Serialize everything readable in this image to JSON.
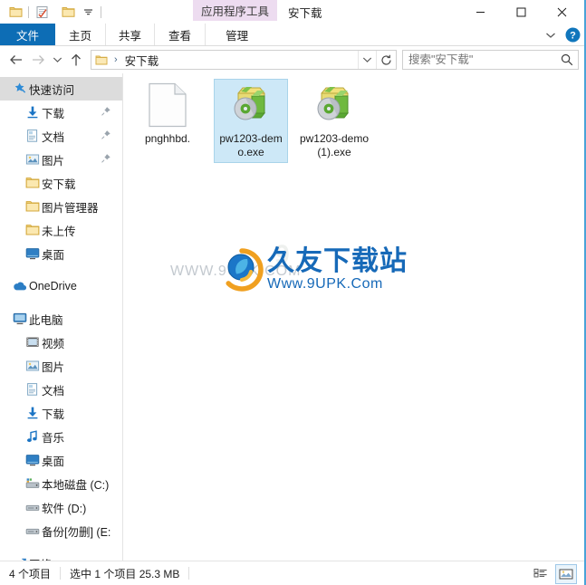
{
  "window": {
    "title": "安下载",
    "contextual_tab": "应用程序工具",
    "minimize_icon": "minimize-icon",
    "maximize_icon": "maximize-icon",
    "close_icon": "close-icon"
  },
  "quick_access_toolbar": {
    "items": [
      {
        "name": "folder-icon",
        "label": "属性"
      },
      {
        "name": "properties-icon",
        "label": "属性"
      },
      {
        "name": "new-folder-icon",
        "label": "新建文件夹"
      },
      {
        "name": "chevron-down-icon",
        "label": "自定义快速访问工具栏"
      }
    ]
  },
  "ribbon": {
    "tabs": [
      {
        "label": "文件",
        "selected": true
      },
      {
        "label": "主页",
        "selected": false
      },
      {
        "label": "共享",
        "selected": false
      },
      {
        "label": "查看",
        "selected": false
      },
      {
        "label": "管理",
        "selected": false
      }
    ],
    "expand_icon": "chevron-down-icon",
    "help_icon": "help-icon",
    "help_label": "?"
  },
  "address_bar": {
    "back_icon": "back-arrow-icon",
    "forward_icon": "forward-arrow-icon",
    "recent_icon": "chevron-down-icon",
    "up_icon": "up-arrow-icon",
    "path_icon": "folder-icon",
    "separator": "›",
    "path_text": "安下载",
    "dropdown_icon": "chevron-down-icon",
    "refresh_icon": "refresh-icon"
  },
  "search": {
    "placeholder": "搜索\"安下载\"",
    "value": "",
    "icon": "search-icon"
  },
  "sidebar": {
    "groups": [
      {
        "items": [
          {
            "label": "快速访问",
            "icon": "star-pin-icon",
            "selected": true,
            "indent": 0,
            "pinned": false
          },
          {
            "label": "下载",
            "icon": "download-icon",
            "selected": false,
            "indent": 1,
            "pinned": true
          },
          {
            "label": "文档",
            "icon": "documents-icon",
            "selected": false,
            "indent": 1,
            "pinned": true
          },
          {
            "label": "图片",
            "icon": "pictures-icon",
            "selected": false,
            "indent": 1,
            "pinned": true
          },
          {
            "label": "安下载",
            "icon": "folder-icon",
            "selected": false,
            "indent": 1,
            "pinned": false
          },
          {
            "label": "图片管理器",
            "icon": "folder-icon",
            "selected": false,
            "indent": 1,
            "pinned": false
          },
          {
            "label": "未上传",
            "icon": "folder-icon",
            "selected": false,
            "indent": 1,
            "pinned": false
          },
          {
            "label": "桌面",
            "icon": "desktop-icon",
            "selected": false,
            "indent": 1,
            "pinned": false
          }
        ]
      },
      {
        "items": [
          {
            "label": "OneDrive",
            "icon": "onedrive-icon",
            "selected": false,
            "indent": 0,
            "pinned": false
          }
        ]
      },
      {
        "items": [
          {
            "label": "此电脑",
            "icon": "this-pc-icon",
            "selected": false,
            "indent": 0,
            "pinned": false
          },
          {
            "label": "视频",
            "icon": "videos-icon",
            "selected": false,
            "indent": 1,
            "pinned": false
          },
          {
            "label": "图片",
            "icon": "pictures-icon",
            "selected": false,
            "indent": 1,
            "pinned": false
          },
          {
            "label": "文档",
            "icon": "documents-icon",
            "selected": false,
            "indent": 1,
            "pinned": false
          },
          {
            "label": "下载",
            "icon": "download-icon",
            "selected": false,
            "indent": 1,
            "pinned": false
          },
          {
            "label": "音乐",
            "icon": "music-icon",
            "selected": false,
            "indent": 1,
            "pinned": false
          },
          {
            "label": "桌面",
            "icon": "desktop-icon",
            "selected": false,
            "indent": 1,
            "pinned": false
          },
          {
            "label": "本地磁盘 (C:)",
            "icon": "system-drive-icon",
            "selected": false,
            "indent": 1,
            "pinned": false
          },
          {
            "label": "软件 (D:)",
            "icon": "drive-icon",
            "selected": false,
            "indent": 1,
            "pinned": false
          },
          {
            "label": "备份[勿删] (E:",
            "icon": "drive-icon",
            "selected": false,
            "indent": 1,
            "pinned": false
          }
        ]
      },
      {
        "items": [
          {
            "label": "网络",
            "icon": "network-icon",
            "selected": false,
            "indent": 0,
            "pinned": false
          }
        ]
      }
    ]
  },
  "files": [
    {
      "name": "pnghhbd.",
      "icon": "blank-document-icon",
      "selected": false
    },
    {
      "name": "pw1203-demo.exe",
      "icon": "setup-package-icon",
      "selected": true
    },
    {
      "name": "pw1203-demo (1).exe",
      "icon": "setup-package-icon",
      "selected": false
    }
  ],
  "watermark": {
    "faint_text": "WWW.9UPK.COM",
    "ghost_text": "9",
    "title_cn": "久友下载站",
    "title_en": "Www.9UPK.Com",
    "logo_icon": "9upk-logo-icon"
  },
  "status_bar": {
    "item_count": "4 个项目",
    "selection": "选中 1 个项目  25.3 MB",
    "details_view_icon": "details-view-icon",
    "large_icons_view_icon": "large-icons-view-icon"
  },
  "colors": {
    "accent": "#0d6db5",
    "selection": "#cde8f7",
    "contextual_tab": "#eddcf0",
    "brand_blue": "#1669b8",
    "brand_orange": "#f0a020"
  }
}
